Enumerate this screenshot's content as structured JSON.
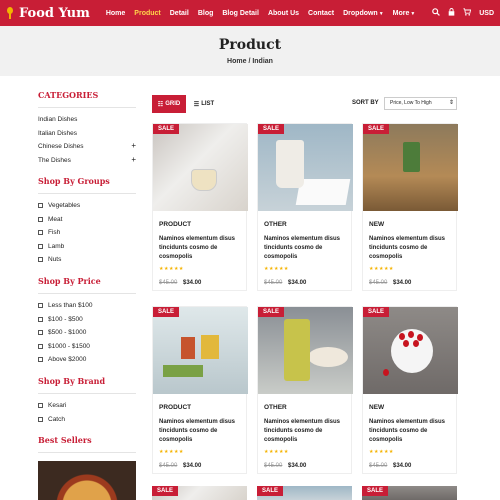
{
  "header": {
    "brand": "Food Yum",
    "nav": [
      {
        "label": "Home",
        "active": false
      },
      {
        "label": "Product",
        "active": true
      },
      {
        "label": "Detail",
        "active": false
      },
      {
        "label": "Blog",
        "active": false
      },
      {
        "label": "Blog Detail",
        "active": false
      },
      {
        "label": "About Us",
        "active": false
      },
      {
        "label": "Contact",
        "active": false
      },
      {
        "label": "Dropdown",
        "active": false,
        "caret": true
      },
      {
        "label": "More",
        "active": false,
        "caret": true
      }
    ],
    "currency": "USD",
    "icons": [
      "search-icon",
      "lock-icon",
      "cart-icon"
    ],
    "accent_color": "#c81e36"
  },
  "page_title": "Product",
  "breadcrumb": "Home / Indian",
  "sidebar": {
    "categories_title": "CATEGORIES",
    "categories": [
      {
        "label": "Indian Dishes",
        "expandable": false
      },
      {
        "label": "Italian Dishes",
        "expandable": false
      },
      {
        "label": "Chinese Dishes",
        "expandable": true
      },
      {
        "label": "The Dishes",
        "expandable": true
      }
    ],
    "group_title": "Shop By Groups",
    "groups": [
      "Vegetables",
      "Meat",
      "Fish",
      "Lamb",
      "Nuts"
    ],
    "price_title": "Shop By Price",
    "prices": [
      "Less than $100",
      "$100 - $500",
      "$500 - $1000",
      "$1000 - $1500",
      "Above $2000"
    ],
    "brand_title": "Shop By Brand",
    "brands": [
      "Kesari",
      "Catch"
    ],
    "bestsellers_title": "Best Sellers"
  },
  "toolbar": {
    "grid_label": "GRID",
    "list_label": "LIST",
    "sort_label": "SORT BY",
    "sort_value": "Price, Low To High"
  },
  "products": [
    {
      "badge": "SALE",
      "type": "PRODUCT",
      "name": "Naminos elementum disus tincidunts cosmo de cosmopolis",
      "old_price": "$45.00",
      "price": "$34.00",
      "rating": 5
    },
    {
      "badge": "SALE",
      "type": "OTHER",
      "name": "Naminos elementum disus tincidunts cosmo de cosmopolis",
      "old_price": "$45.00",
      "price": "$34.00",
      "rating": 5
    },
    {
      "badge": "SALE",
      "type": "NEW",
      "name": "Naminos elementum disus tincidunts cosmo de cosmopolis",
      "old_price": "$45.00",
      "price": "$34.00",
      "rating": 5
    },
    {
      "badge": "SALE",
      "type": "PRODUCT",
      "name": "Naminos elementum disus tincidunts cosmo de cosmopolis",
      "old_price": "$45.00",
      "price": "$34.00",
      "rating": 5
    },
    {
      "badge": "SALE",
      "type": "OTHER",
      "name": "Naminos elementum disus tincidunts cosmo de cosmopolis",
      "old_price": "$45.00",
      "price": "$34.00",
      "rating": 5
    },
    {
      "badge": "SALE",
      "type": "NEW",
      "name": "Naminos elementum disus tincidunts cosmo de cosmopolis",
      "old_price": "$45.00",
      "price": "$34.00",
      "rating": 5
    }
  ],
  "next_row_badges": [
    "SALE",
    "SALE",
    "SALE"
  ]
}
